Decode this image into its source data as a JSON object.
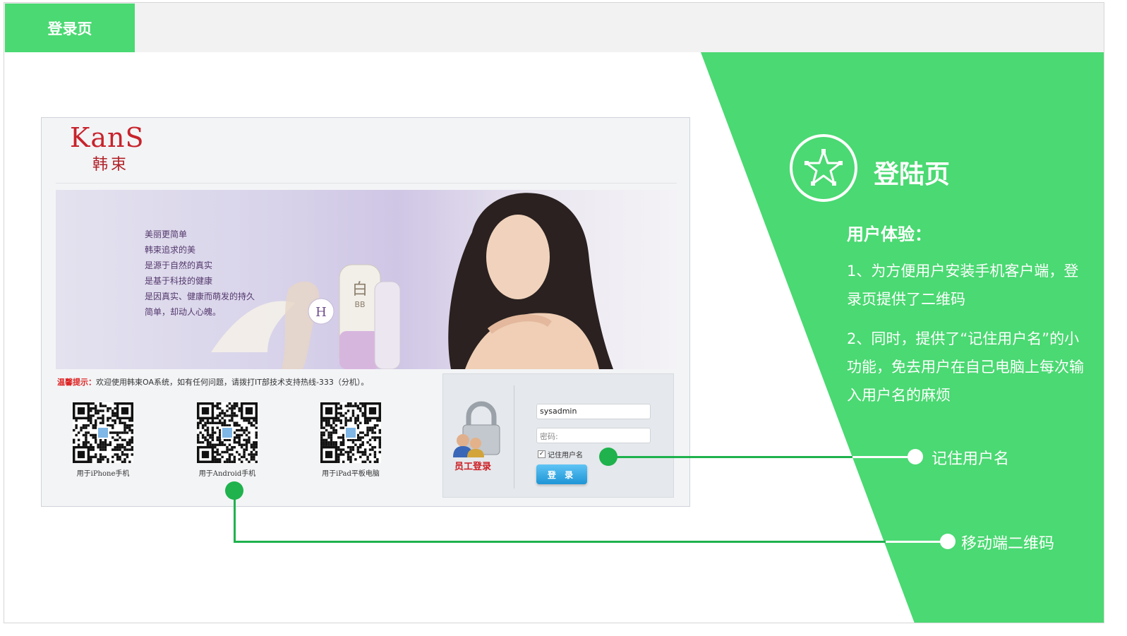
{
  "tab": {
    "label": "登录页"
  },
  "panel": {
    "logo_brand": "KanS",
    "logo_cn": "韩束",
    "banner_lines": [
      "美丽更简单",
      "韩束追求的美",
      "是源于自然的真实",
      "是基于科技的健康",
      "是因真实、健康而萌发的持久",
      "简单，却动人心魄。"
    ],
    "tip_label": "温馨提示：",
    "tip_text": "欢迎使用韩束OA系统，如有任何问题，请拨打IT部技术支持热线-333（分机）。",
    "qr_items": [
      {
        "caption": "用于iPhone手机"
      },
      {
        "caption": "用于Android手机"
      },
      {
        "caption": "用于iPad平板电脑"
      }
    ],
    "login": {
      "staff_login_label": "员工登录",
      "username_value": "sysadmin",
      "password_placeholder": "密码:",
      "remember_label": "记住用户名",
      "remember_checked": true,
      "login_button": "登 录"
    }
  },
  "right": {
    "heading": "登陆页",
    "ux_title": "用户体验：",
    "para1": "1、为方便用户安装手机客户端，登录页提供了二维码",
    "para2": "2、同时，提供了“记住用户名”的小功能，免去用户在自己电脑上每次输入用户名的麻烦"
  },
  "callouts": {
    "remember": "记住用户名",
    "qr": "移动端二维码"
  },
  "colors": {
    "green": "#4ad972",
    "dark_green": "#1fb24d",
    "login_red": "#cc1d22",
    "button_blue": "#1e95d6"
  }
}
